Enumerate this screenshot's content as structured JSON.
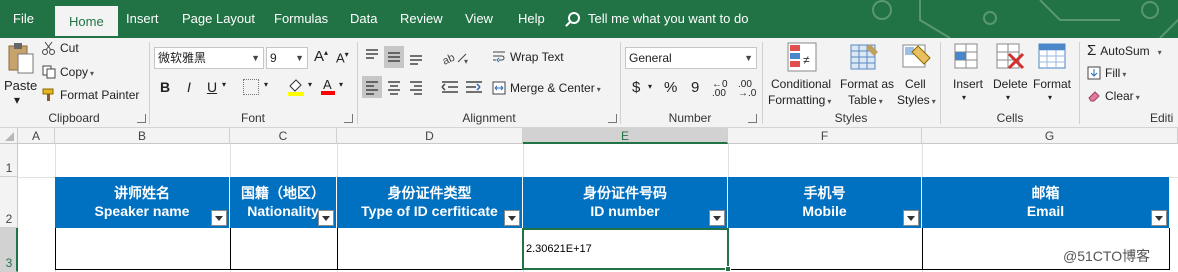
{
  "tabs": [
    "File",
    "Home",
    "Insert",
    "Page Layout",
    "Formulas",
    "Data",
    "Review",
    "View",
    "Help"
  ],
  "tell_me": "Tell me what you want to do",
  "clipboard": {
    "paste": "Paste",
    "cut": "Cut",
    "copy": "Copy",
    "format_painter": "Format Painter",
    "group": "Clipboard"
  },
  "font": {
    "name": "微软雅黑",
    "size": "9",
    "bold": "B",
    "italic": "I",
    "underline": "U",
    "group": "Font"
  },
  "alignment": {
    "wrap": "Wrap Text",
    "merge": "Merge & Center",
    "group": "Alignment"
  },
  "number": {
    "format": "General",
    "currency": "$",
    "percent": "%",
    "comma": "9",
    "group": "Number"
  },
  "styles": {
    "conditional_1": "Conditional",
    "conditional_2": "Formatting",
    "format_table_1": "Format as",
    "format_table_2": "Table",
    "cell_styles_1": "Cell",
    "cell_styles_2": "Styles",
    "group": "Styles"
  },
  "cells": {
    "insert": "Insert",
    "delete": "Delete",
    "format": "Format",
    "group": "Cells"
  },
  "editing": {
    "autosum": "AutoSum",
    "fill": "Fill",
    "clear": "Clear",
    "group": "Editi"
  },
  "columns": [
    "A",
    "B",
    "C",
    "D",
    "E",
    "F",
    "G"
  ],
  "rows": [
    "1",
    "2",
    "3"
  ],
  "table": {
    "headers": [
      {
        "zh": "讲师姓名",
        "en": "Speaker name"
      },
      {
        "zh": "国籍（地区）",
        "en": "Nationality"
      },
      {
        "zh": "身份证件类型",
        "en": "Type of ID cerfiticate"
      },
      {
        "zh": "身份证件号码",
        "en": "ID number"
      },
      {
        "zh": "手机号",
        "en": "Mobile"
      },
      {
        "zh": "邮箱",
        "en": "Email"
      }
    ],
    "id_value": "2.30621E+17"
  },
  "watermark": "@51CTO博客",
  "colors": {
    "excel_green": "#217346",
    "header_blue": "#0070c0"
  }
}
